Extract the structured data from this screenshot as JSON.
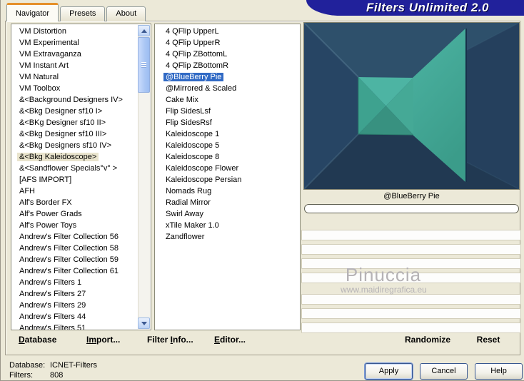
{
  "window": {
    "banner_title": "Filters Unlimited 2.0"
  },
  "tabs": [
    {
      "label": "Navigator",
      "active": true
    },
    {
      "label": "Presets",
      "active": false
    },
    {
      "label": "About",
      "active": false
    }
  ],
  "left_list": {
    "selected": "&<Bkg Kaleidoscope>",
    "items": [
      "VM Distortion",
      "VM Experimental",
      "VM Extravaganza",
      "VM Instant Art",
      "VM Natural",
      "VM Toolbox",
      "&<Background Designers IV>",
      "&<Bkg Designer sf10 I>",
      "&<BKg Designer sf10 II>",
      "&<Bkg Designer sf10 III>",
      "&<Bkg Designers sf10 IV>",
      "&<Bkg Kaleidoscope>",
      "&<Sandflower Specials°v° >",
      "[AFS IMPORT]",
      "AFH",
      "Alf's Border FX",
      "Alf's Power Grads",
      "Alf's Power Toys",
      "Andrew's Filter Collection 56",
      "Andrew's Filter Collection 58",
      "Andrew's Filter Collection 59",
      "Andrew's Filter Collection 61",
      "Andrew's Filters 1",
      "Andrew's Filters 27",
      "Andrew's Filters 29",
      "Andrew's Filters 44",
      "Andrew's Filters 51"
    ]
  },
  "filter_list": {
    "selected": "@BlueBerry Pie",
    "items": [
      "4 QFlip UpperL",
      "4 QFlip UpperR",
      "4 QFlip ZBottomL",
      "4 QFlip ZBottomR",
      "@BlueBerry Pie",
      "@Mirrored & Scaled",
      "Cake Mix",
      "Flip SidesLsf",
      "Flip SidesRsf",
      "Kaleidoscope 1",
      "Kaleidoscope 5",
      "Kaleidoscope 8",
      "Kaleidoscope Flower",
      "Kaleidoscope Persian",
      "Nomads Rug",
      "Radial Mirror",
      "Swirl Away",
      "xTile Maker 1.0",
      "Zandflower"
    ]
  },
  "preview": {
    "caption": "@BlueBerry Pie",
    "watermark_line1": "Pinuccia",
    "watermark_line2": "www.maidiregrafica.eu"
  },
  "footer_menu": {
    "items": [
      {
        "pre": "",
        "accel": "D",
        "post": "atabase"
      },
      {
        "pre": "",
        "accel": "Im",
        "post": "port..."
      },
      {
        "pre": "Filter ",
        "accel": "I",
        "post": "nfo..."
      },
      {
        "pre": "",
        "accel": "E",
        "post": "ditor..."
      }
    ]
  },
  "controls": {
    "randomize": "Randomize",
    "reset": "Reset"
  },
  "status": {
    "database_label": "Database:",
    "database_value": "ICNET-Filters",
    "filters_label": "Filters:",
    "filters_value": "808"
  },
  "action_buttons": {
    "apply": "Apply",
    "cancel": "Cancel",
    "help": "Help"
  },
  "colors": {
    "dialog_bg": "#ece9d8",
    "banner_bg": "#21219b",
    "selection_bg": "#316ac5",
    "inactive_selection_bg": "#e9e4cd",
    "tab_accent_orange": "#e5902a",
    "preview_teal": "#3fa18e",
    "preview_navy": "#264260"
  }
}
